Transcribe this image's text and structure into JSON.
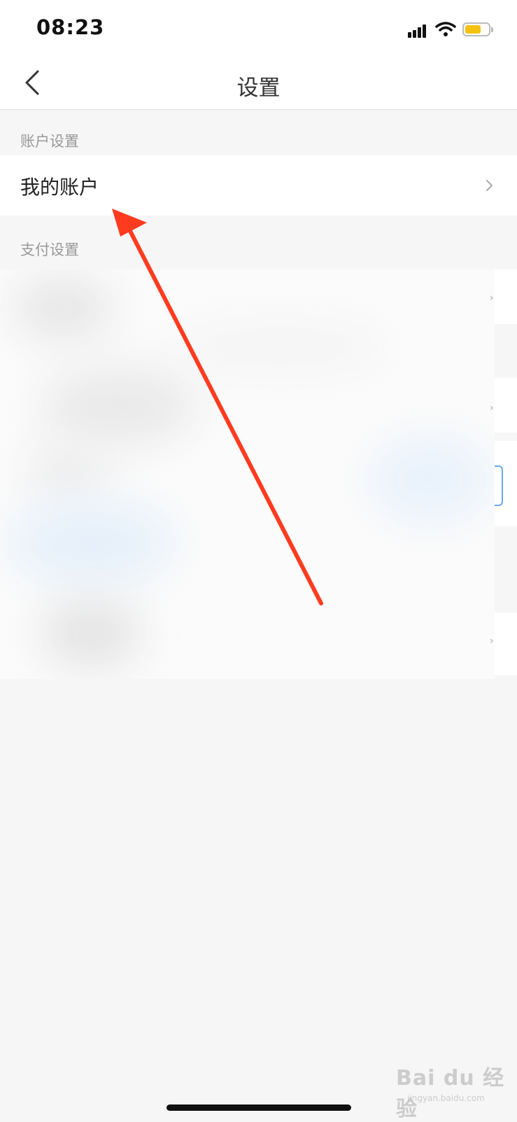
{
  "status": {
    "time": "08:23",
    "battery_color": "#f4c20d"
  },
  "navbar": {
    "back_icon": "chevron-left-icon",
    "title": "设置"
  },
  "sections": [
    {
      "title": "账户设置",
      "items": [
        {
          "label": "我的账户",
          "icon": "chevron-right-icon"
        }
      ]
    },
    {
      "title": "支付设置"
    }
  ],
  "annotation": {
    "arrow_color": "#ff3b1f",
    "points_to": "我的账户"
  },
  "watermark": {
    "text": "Bai du 经验",
    "url": "jingyan.baidu.com"
  }
}
